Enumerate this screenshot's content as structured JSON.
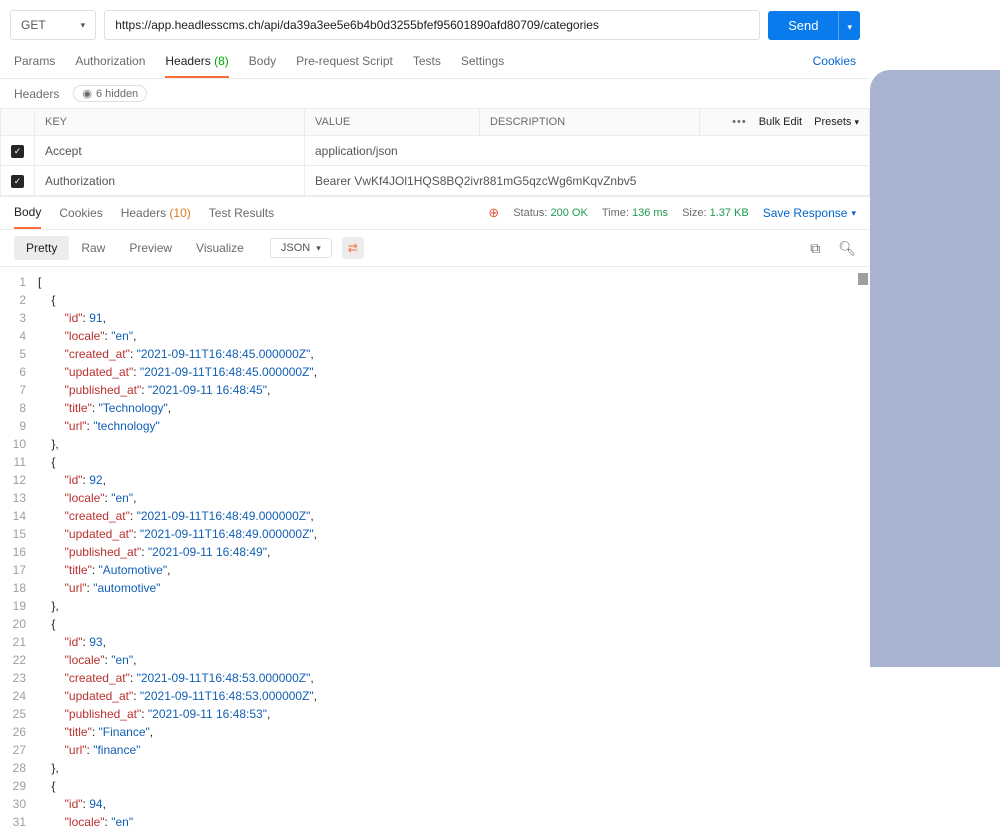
{
  "request": {
    "method": "GET",
    "url": "https://app.headlesscms.ch/api/da39a3ee5e6b4b0d3255bfef95601890afd80709/categories",
    "send_label": "Send"
  },
  "request_tabs": {
    "items": [
      "Params",
      "Authorization",
      "Headers",
      "Body",
      "Pre-request Script",
      "Tests",
      "Settings"
    ],
    "headers_count": "(8)",
    "cookies": "Cookies"
  },
  "headers_sub": {
    "label": "Headers",
    "hidden": "6 hidden"
  },
  "headers_table": {
    "cols": {
      "key": "KEY",
      "value": "VALUE",
      "desc": "DESCRIPTION",
      "bulk": "Bulk Edit",
      "presets": "Presets"
    },
    "rows": [
      {
        "key": "Accept",
        "value": "application/json"
      },
      {
        "key": "Authorization",
        "value": "Bearer VwKf4JOl1HQS8BQ2ivr881mG5qzcWg6mKqvZnbv5"
      }
    ]
  },
  "response_tabs": {
    "items": [
      "Body",
      "Cookies",
      "Headers",
      "Test Results"
    ],
    "headers_count": "(10)"
  },
  "status": {
    "status_label": "Status:",
    "status_value": "200 OK",
    "time_label": "Time:",
    "time_value": "136 ms",
    "size_label": "Size:",
    "size_value": "1.37 KB",
    "save": "Save Response"
  },
  "viewer": {
    "modes": [
      "Pretty",
      "Raw",
      "Preview",
      "Visualize"
    ],
    "format": "JSON"
  },
  "json_body": [
    {
      "id": 91,
      "locale": "en",
      "created_at": "2021-09-11T16:48:45.000000Z",
      "updated_at": "2021-09-11T16:48:45.000000Z",
      "published_at": "2021-09-11 16:48:45",
      "title": "Technology",
      "url": "technology"
    },
    {
      "id": 92,
      "locale": "en",
      "created_at": "2021-09-11T16:48:49.000000Z",
      "updated_at": "2021-09-11T16:48:49.000000Z",
      "published_at": "2021-09-11 16:48:49",
      "title": "Automotive",
      "url": "automotive"
    },
    {
      "id": 93,
      "locale": "en",
      "created_at": "2021-09-11T16:48:53.000000Z",
      "updated_at": "2021-09-11T16:48:53.000000Z",
      "published_at": "2021-09-11 16:48:53",
      "title": "Finance",
      "url": "finance"
    },
    {
      "id": 94,
      "locale": "en"
    }
  ]
}
